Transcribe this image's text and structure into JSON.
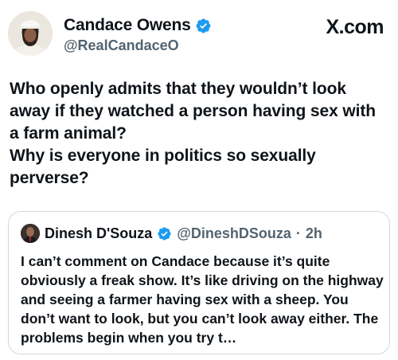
{
  "author": {
    "display_name": "Candace Owens",
    "handle": "@RealCandaceO",
    "verified": true
  },
  "brand": "X.com",
  "tweet": {
    "lines": [
      "Who openly admits that they wouldn’t look away if they watched a person having sex with a farm animal?",
      "Why is everyone in politics so sexually perverse?"
    ]
  },
  "quoted": {
    "display_name": "Dinesh D'Souza",
    "handle": "@DineshDSouza",
    "separator": "·",
    "time": "2h",
    "verified": true,
    "text": "I can’t comment on Candace because it’s quite obviously a freak show. It’s like driving on the highway and seeing a farmer having sex with a sheep. You don’t want to look, but you can’t look away either. The problems begin when you try t…"
  },
  "colors": {
    "verified_badge": "#1d9bf0",
    "secondary_text": "#536471",
    "border": "#cfd9de"
  },
  "icons": [
    "verified-badge-icon",
    "x-logo"
  ]
}
